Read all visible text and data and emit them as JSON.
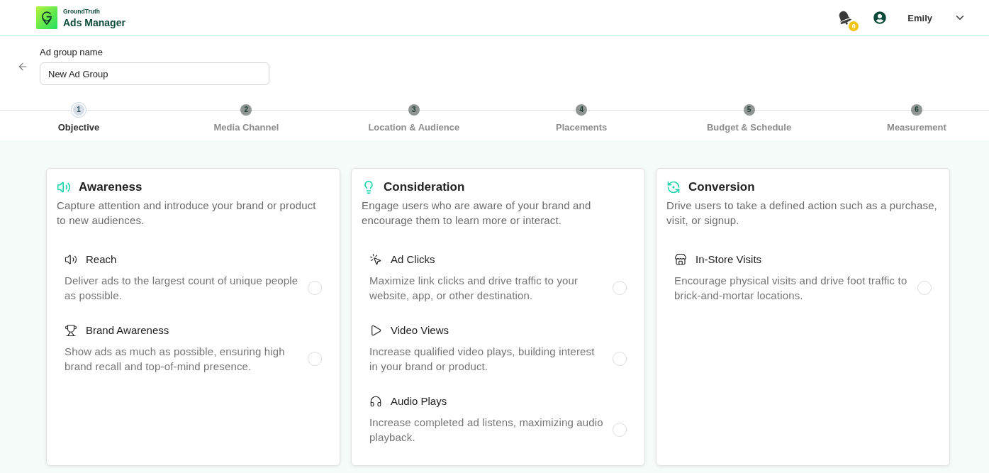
{
  "header": {
    "brand": {
      "company": "GroundTruth",
      "product": "Ads Manager"
    },
    "notifications": {
      "count": "0"
    },
    "user": {
      "name": "Emily"
    }
  },
  "ad_group_name": {
    "label": "Ad group name",
    "value": "New Ad Group"
  },
  "steps": [
    {
      "number": "1",
      "label": "Objective",
      "selected": true
    },
    {
      "number": "2",
      "label": "Media Channel",
      "selected": false
    },
    {
      "number": "3",
      "label": "Location & Audience",
      "selected": false
    },
    {
      "number": "4",
      "label": "Placements",
      "selected": false
    },
    {
      "number": "5",
      "label": "Budget & Schedule",
      "selected": false
    },
    {
      "number": "6",
      "label": "Measurement",
      "selected": false
    }
  ],
  "objectives": [
    {
      "kind": "awareness",
      "title": "Awareness",
      "description": "Capture attention and introduce your brand or product to new audiences.",
      "options": [
        {
          "kind": "reach",
          "title": "Reach",
          "description": "Deliver ads to the largest count of unique people as possible.",
          "selected": false
        },
        {
          "kind": "brand_awareness",
          "title": "Brand Awareness",
          "description": "Show ads as much as possible, ensuring high brand recall and top-of-mind presence.",
          "selected": false
        }
      ]
    },
    {
      "kind": "consideration",
      "title": "Consideration",
      "description": "Engage users who are aware of your brand and encourage them to learn more or interact.",
      "options": [
        {
          "kind": "ad_clicks",
          "title": "Ad Clicks",
          "description": "Maximize link clicks and drive traffic to your website, app, or other destination.",
          "selected": false
        },
        {
          "kind": "video_views",
          "title": "Video Views",
          "description": "Increase qualified video plays, building interest in your brand or product.",
          "selected": false
        },
        {
          "kind": "audio_plays",
          "title": "Audio Plays",
          "description": "Increase completed ad listens, maximizing audio playback.",
          "selected": false
        }
      ]
    },
    {
      "kind": "conversion",
      "title": "Conversion",
      "description": "Drive users to take a defined action such as a purchase, visit, or signup.",
      "options": [
        {
          "kind": "in_store_visits",
          "title": "In-Store Visits",
          "description": "Encourage physical visits and drive foot traffic to brick-and-mortar locations.",
          "selected": false
        }
      ]
    }
  ]
}
